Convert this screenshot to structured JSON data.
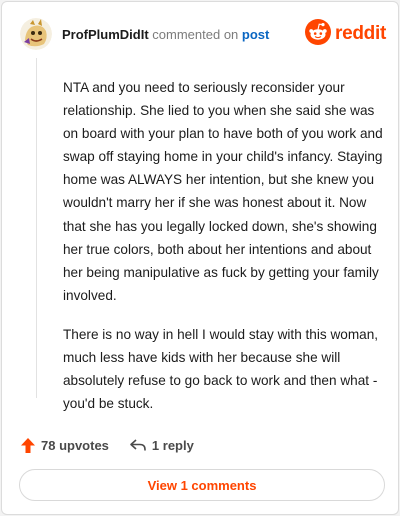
{
  "comment": {
    "username": "ProfPlumDidIt",
    "action_text": "commented on",
    "post_link": "post",
    "paragraphs": [
      "NTA and you need to seriously reconsider your relationship. She lied to you when she said she was on board with your plan to have both of you work and swap off staying home in your child's infancy. Staying home was ALWAYS her intention, but she knew you wouldn't marry her if she was honest about it. Now that she has you legally locked down, she's showing her true colors, both about her intentions and about her being manipulative as fuck by getting your family involved.",
      "There is no way in hell I would stay with this woman, much less have kids with her because she will absolutely refuse to go back to work and then what - you'd be stuck."
    ]
  },
  "brand": {
    "name": "reddit",
    "icon": "reddit-logo-icon",
    "color": "#ff4500"
  },
  "actions": {
    "upvotes": "78 upvotes",
    "replies": "1 reply"
  },
  "footer": {
    "view_comments": "View 1 comments"
  },
  "colors": {
    "accent": "#ff4500",
    "link": "#0a66c2",
    "text": "#1c1c1c",
    "muted": "#7c7c7c"
  }
}
